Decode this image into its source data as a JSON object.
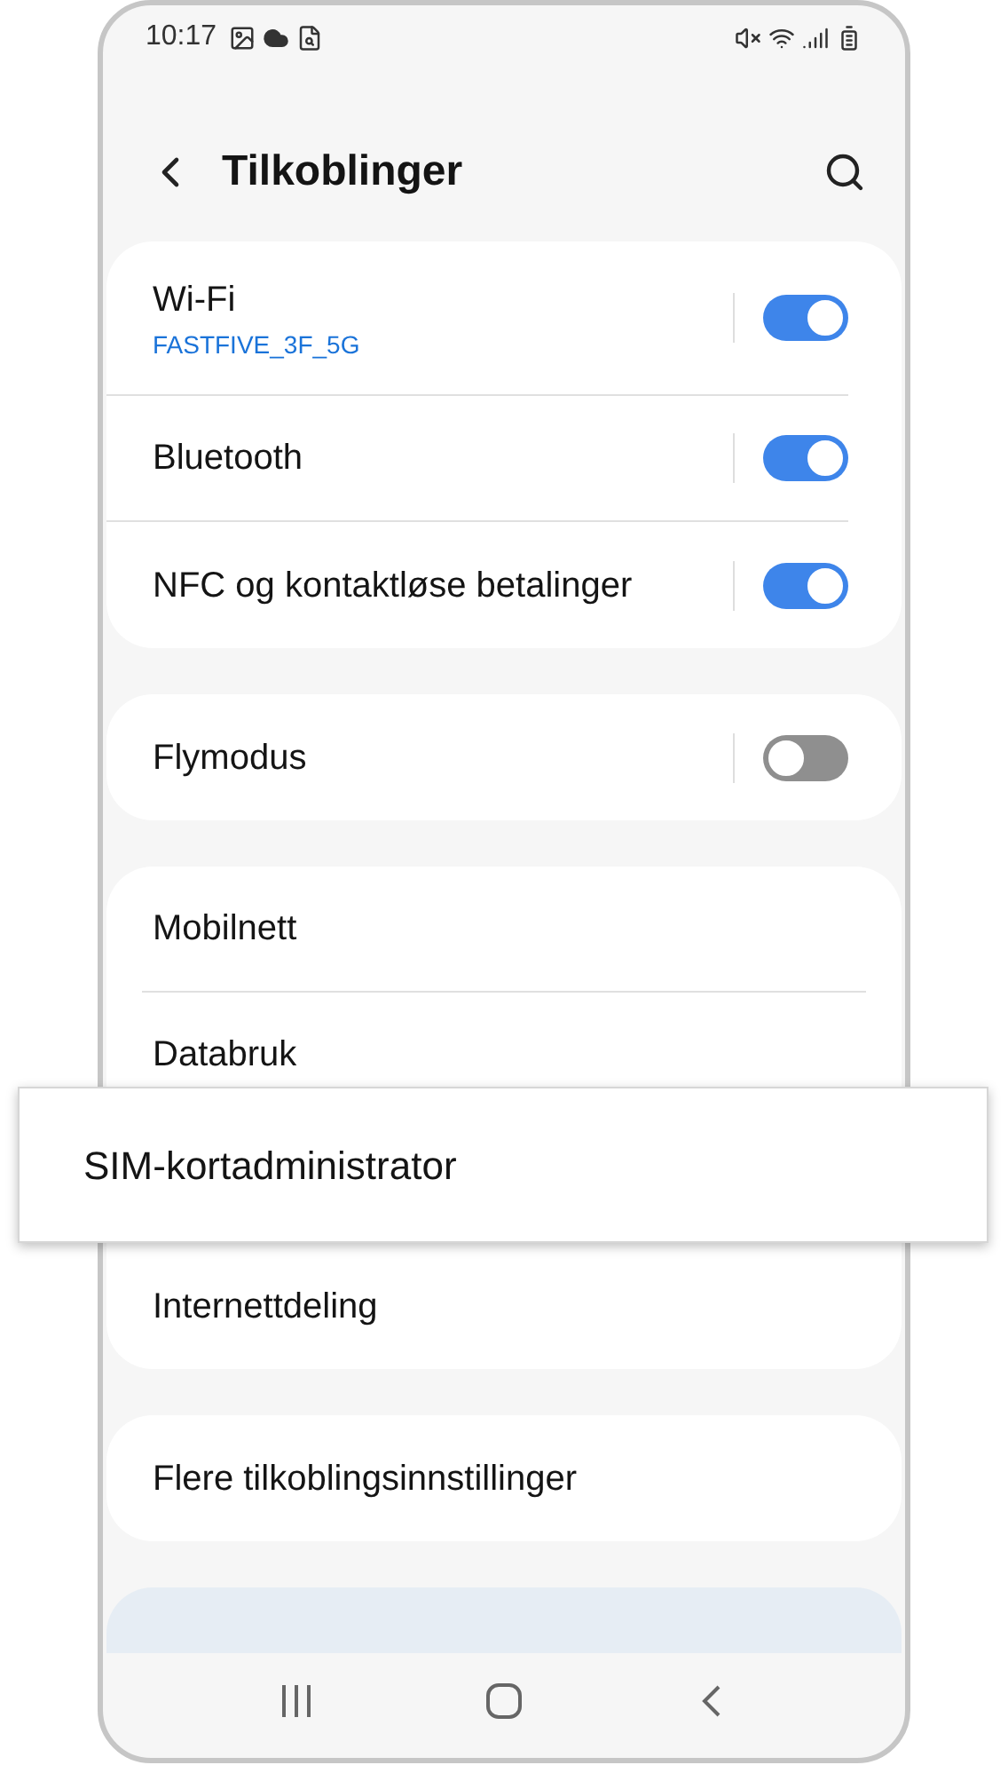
{
  "status_bar": {
    "time": "10:17"
  },
  "header": {
    "title": "Tilkoblinger"
  },
  "groups": [
    {
      "items": [
        {
          "kind": "toggle",
          "label": "Wi-Fi",
          "subtitle": "FASTFIVE_3F_5G",
          "on": true
        },
        {
          "kind": "toggle",
          "label": "Bluetooth",
          "on": true
        },
        {
          "kind": "toggle",
          "label": "NFC og kontaktløse betalinger",
          "on": true
        }
      ]
    },
    {
      "items": [
        {
          "kind": "toggle",
          "label": "Flymodus",
          "on": false
        }
      ]
    },
    {
      "items": [
        {
          "kind": "link",
          "label": "Mobilnett"
        },
        {
          "kind": "link",
          "label": "Databruk"
        },
        {
          "kind": "callout",
          "label": "SIM-kortadministrator"
        },
        {
          "kind": "link",
          "label": "Internettdeling"
        }
      ]
    },
    {
      "items": [
        {
          "kind": "link",
          "label": "Flere tilkoblingsinnstillinger"
        }
      ]
    }
  ]
}
